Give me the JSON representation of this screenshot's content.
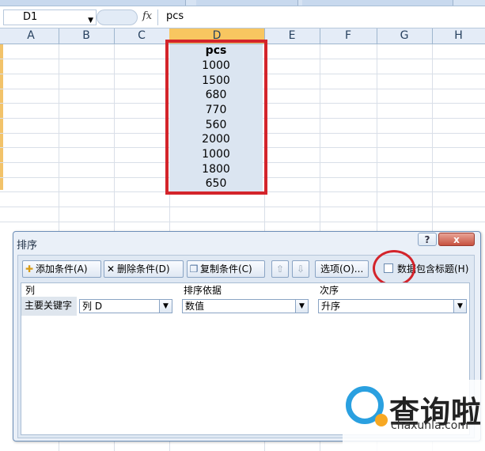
{
  "formula_bar": {
    "name_box": "D1",
    "fx": "fx",
    "value": "pcs"
  },
  "columns": [
    "A",
    "B",
    "C",
    "D",
    "E",
    "F",
    "G",
    "H"
  ],
  "column_d_values": [
    "pcs",
    "1000",
    "1500",
    "680",
    "770",
    "560",
    "2000",
    "1000",
    "1800",
    "650"
  ],
  "dialog": {
    "title": "排序",
    "help": "?",
    "close": "x",
    "toolbar": {
      "add_condition": "添加条件(A)",
      "delete_condition": "删除条件(D)",
      "copy_condition": "复制条件(C)",
      "move_up": "⇧",
      "move_down": "⇩",
      "options": "选项(O)...",
      "has_header": "数据包含标题(H)"
    },
    "table": {
      "headers": [
        "列",
        "排序依据",
        "次序"
      ],
      "row_label": "主要关键字",
      "column_value": "列 D",
      "sort_on_value": "数值",
      "order_value": "升序"
    }
  },
  "watermark": {
    "chinese": "查询啦",
    "url": "chaxunla.com"
  },
  "colors": {
    "highlight_red": "#d3242b",
    "selected_header": "#f8c660",
    "selected_column": "#dbe5f1",
    "dialog_bg": "#eaf0f8"
  }
}
